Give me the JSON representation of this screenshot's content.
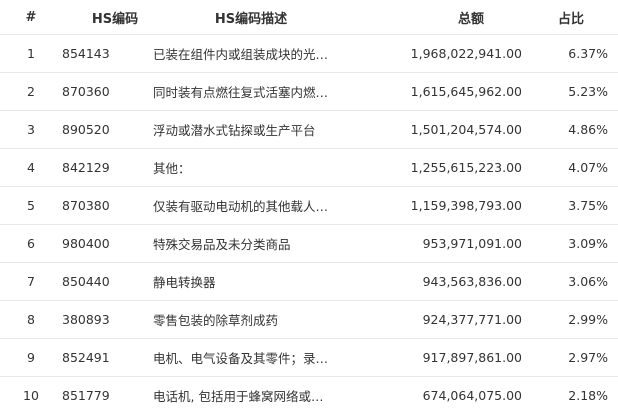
{
  "headers": {
    "index": "#",
    "code": "HS编码",
    "description": "HS编码描述",
    "total": "总额",
    "share": "占比"
  },
  "rows": [
    {
      "index": "1",
      "code": "854143",
      "description": "已装在组件内或组装成块的光…",
      "total": "1,968,022,941.00",
      "share": "6.37%"
    },
    {
      "index": "2",
      "code": "870360",
      "description": "同时装有点燃往复式活塞内燃…",
      "total": "1,615,645,962.00",
      "share": "5.23%"
    },
    {
      "index": "3",
      "code": "890520",
      "description": "浮动或潜水式钻探或生产平台",
      "total": "1,501,204,574.00",
      "share": "4.86%"
    },
    {
      "index": "4",
      "code": "842129",
      "description": "其他：",
      "total": "1,255,615,223.00",
      "share": "4.07%"
    },
    {
      "index": "5",
      "code": "870380",
      "description": "仅装有驱动电动机的其他载人…",
      "total": "1,159,398,793.00",
      "share": "3.75%"
    },
    {
      "index": "6",
      "code": "980400",
      "description": "特殊交易品及未分类商品",
      "total": "953,971,091.00",
      "share": "3.09%"
    },
    {
      "index": "7",
      "code": "850440",
      "description": "静电转换器",
      "total": "943,563,836.00",
      "share": "3.06%"
    },
    {
      "index": "8",
      "code": "380893",
      "description": "零售包装的除草剂成药",
      "total": "924,377,771.00",
      "share": "2.99%"
    },
    {
      "index": "9",
      "code": "852491",
      "description": "电机、电气设备及其零件；录…",
      "total": "917,897,861.00",
      "share": "2.97%"
    },
    {
      "index": "10",
      "code": "851779",
      "description": "电话机, 包括用于蜂窝网络或…",
      "total": "674,064,075.00",
      "share": "2.18%"
    }
  ]
}
